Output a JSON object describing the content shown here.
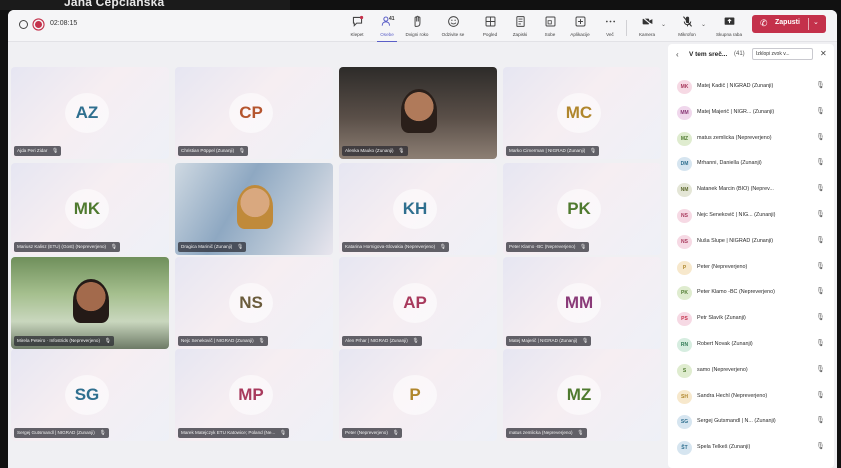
{
  "overlay_name": "Jana Čepčianska",
  "topbar": {
    "timer": "02:08:15",
    "participant_count": "41",
    "items": [
      {
        "key": "chat",
        "label": "Klepet",
        "icon": "chat-icon"
      },
      {
        "key": "people",
        "label": "Osebe",
        "icon": "people-icon"
      },
      {
        "key": "raise",
        "label": "Dvigni roko",
        "icon": "raise-hand-icon"
      },
      {
        "key": "react",
        "label": "Odzivite se",
        "icon": "react-icon"
      },
      {
        "key": "view",
        "label": "Pogled",
        "icon": "view-icon"
      },
      {
        "key": "notes",
        "label": "Zapiski",
        "icon": "notes-icon"
      },
      {
        "key": "rooms",
        "label": "Sobe",
        "icon": "rooms-icon"
      },
      {
        "key": "apps",
        "label": "Aplikacije",
        "icon": "apps-icon"
      },
      {
        "key": "more",
        "label": "Več",
        "icon": "more-icon"
      },
      {
        "key": "camera",
        "label": "Kamera",
        "icon": "camera-off-icon"
      },
      {
        "key": "mic",
        "label": "Mikrofon",
        "icon": "mic-off-icon"
      },
      {
        "key": "share",
        "label": "Skupna raba",
        "icon": "share-icon"
      }
    ],
    "leave_label": "Zapusti"
  },
  "tiles": [
    {
      "initials": "AZ",
      "name": "Ajda Peri Zidar",
      "color": "#2f6f8f"
    },
    {
      "initials": "CP",
      "name": "Christian Pöppel (Zunanji)",
      "color": "#b5552e"
    },
    {
      "initials": "",
      "name": "Alenka Mauko (Zunanji)",
      "color": "#333333",
      "video": true
    },
    {
      "initials": "MC",
      "name": "Marko Cimerman | NIGRAD (Zunanji)",
      "color": "#b0862c"
    },
    {
      "initials": "MK",
      "name": "Mariusz Kalisz (ETU) (Gost) (Nepreverjeno)",
      "color": "#4f7a2f"
    },
    {
      "initials": "",
      "name": "Dragica Marinič (Zunanji)",
      "color": "#333333",
      "video": true
    },
    {
      "initials": "KH",
      "name": "Katarina Hornigova-Slovakia (Nepreverjeno)",
      "color": "#2f6f8f"
    },
    {
      "initials": "PK",
      "name": "Peter Klamo -BC (Nepreverjeno)",
      "color": "#4f7a2f"
    },
    {
      "initials": "",
      "name": "Mirela Peteiro · Infostrids (Nepreverjeno)",
      "color": "#333333",
      "video": true
    },
    {
      "initials": "NS",
      "name": "Nejc Senekovič | NIGRAD (Zunanji)",
      "color": "#6b5c3c"
    },
    {
      "initials": "AP",
      "name": "Alen Prhar | NIGRAD (Zunanji)",
      "color": "#a83a5d"
    },
    {
      "initials": "MM",
      "name": "Matej Majerič | NIGRAD (Zunanji)",
      "color": "#8a3a78"
    },
    {
      "initials": "SG",
      "name": "Sergej Gutsmandl | NIGRAD (Zunanji)",
      "color": "#2f6f8f"
    },
    {
      "initials": "MP",
      "name": "Marek Matejczyk ETU Katowice; Poland (Ne...",
      "color": "#a83a5d"
    },
    {
      "initials": "P",
      "name": "Peter (Nepreverjeno)",
      "color": "#b0862c"
    },
    {
      "initials": "MZ",
      "name": "matus zemlicka (Nepreverjeno)",
      "color": "#4f7a2f"
    }
  ],
  "panel": {
    "title": "V tem sreč...",
    "count": "(41)",
    "mute_all": "Izklopi zvok v...",
    "participants": [
      {
        "initials": "MK",
        "name": "Matej Kadič | NIGRAD (Zunanji)",
        "bg": "#f6d9e4",
        "fg": "#a83a5d"
      },
      {
        "initials": "MM",
        "name": "Matej Majerič | NIGR... (Zunanji)",
        "bg": "#f0d7ec",
        "fg": "#8a3a78"
      },
      {
        "initials": "MZ",
        "name": "matus zemlicka (Nepreverjeno)",
        "bg": "#dfeccf",
        "fg": "#4f7a2f"
      },
      {
        "initials": "DM",
        "name": "Mrhanni, Daniella (Zunanji)",
        "bg": "#d6e5f0",
        "fg": "#2f6f8f"
      },
      {
        "initials": "NM",
        "name": "Natanek Marcin (BIO) (Neprev...",
        "bg": "#e4e6d6",
        "fg": "#5f6b2f"
      },
      {
        "initials": "NS",
        "name": "Nejc Senekovič | NIG... (Zunanji)",
        "bg": "#f6d9e4",
        "fg": "#a83a5d"
      },
      {
        "initials": "NS",
        "name": "Nuša Slupe | NIGRAD (Zunanji)",
        "bg": "#f6d9e4",
        "fg": "#a83a5d"
      },
      {
        "initials": "P",
        "name": "Peter (Nepreverjeno)",
        "bg": "#f7e8cc",
        "fg": "#b0862c"
      },
      {
        "initials": "PK",
        "name": "Peter Klamo -BC (Nepreverjeno)",
        "bg": "#dfeccf",
        "fg": "#4f7a2f"
      },
      {
        "initials": "PS",
        "name": "Petr Slavík (Zunanji)",
        "bg": "#f6d9e4",
        "fg": "#c4314b"
      },
      {
        "initials": "RN",
        "name": "Robert Novak (Zunanji)",
        "bg": "#d6ede0",
        "fg": "#2f7a55"
      },
      {
        "initials": "S",
        "name": "samo (Nepreverjeno)",
        "bg": "#dfeccf",
        "fg": "#4f7a2f"
      },
      {
        "initials": "SH",
        "name": "Sandra Hechl (Nepreverjeno)",
        "bg": "#f7e8cc",
        "fg": "#b0862c"
      },
      {
        "initials": "SG",
        "name": "Sergej Gutsmandl | N... (Zunanji)",
        "bg": "#d6e5f0",
        "fg": "#2f6f8f"
      },
      {
        "initials": "ŠT",
        "name": "Špela Telkeš (Zunanji)",
        "bg": "#d6e5f0",
        "fg": "#2f6f8f"
      }
    ]
  }
}
